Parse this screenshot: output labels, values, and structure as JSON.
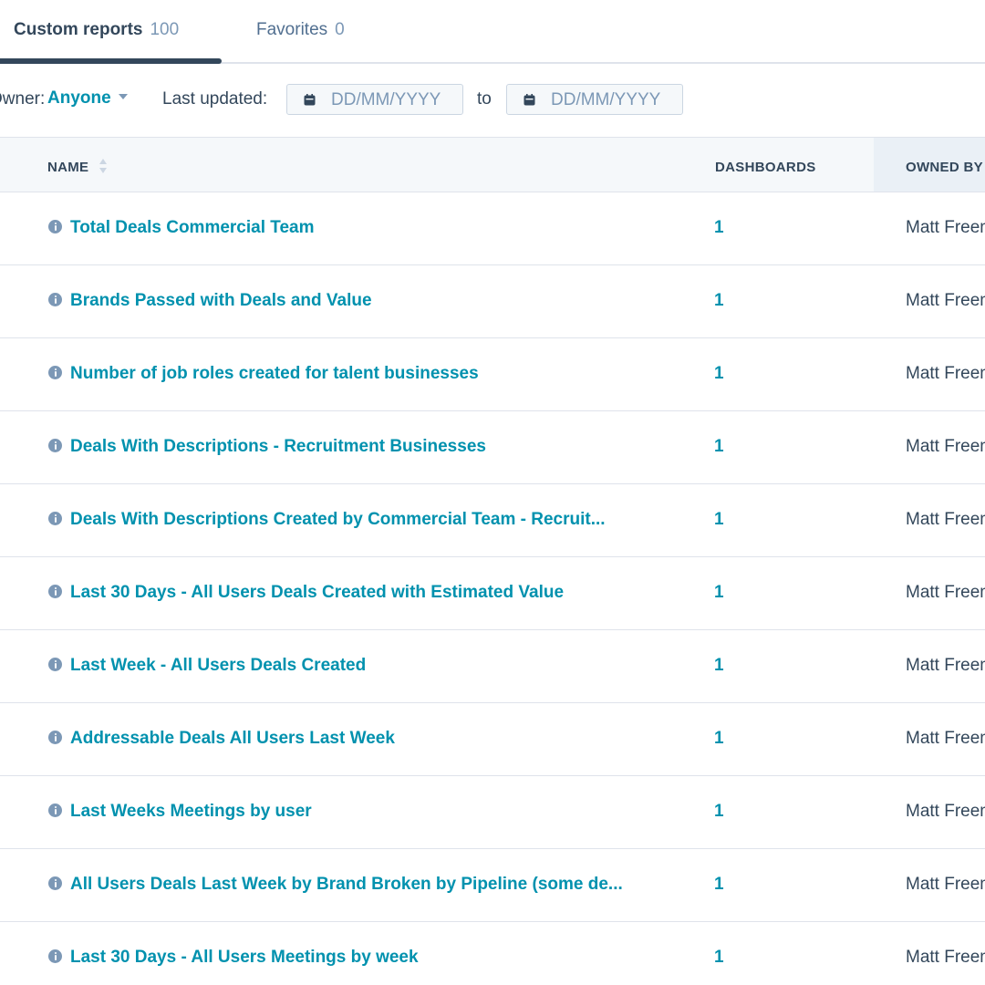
{
  "tabs": [
    {
      "label": "Custom reports",
      "count": "100"
    },
    {
      "label": "Favorites",
      "count": "0"
    }
  ],
  "filters": {
    "owner_label": "Owner:",
    "owner_value": "Anyone",
    "updated_label": "Last updated:",
    "date_from_placeholder": "DD/MM/YYYY",
    "to_label": "to",
    "date_to_placeholder": "DD/MM/YYYY"
  },
  "table": {
    "columns": {
      "name": "NAME",
      "dashboards": "DASHBOARDS",
      "owned_by": "OWNED BY"
    },
    "rows": [
      {
        "name": "Total Deals Commercial Team",
        "dashboards": "1",
        "owner": "Matt Freeman"
      },
      {
        "name": "Brands Passed with Deals and Value",
        "dashboards": "1",
        "owner": "Matt Freeman"
      },
      {
        "name": "Number of job roles created for talent businesses",
        "dashboards": "1",
        "owner": "Matt Freeman"
      },
      {
        "name": "Deals With Descriptions - Recruitment Businesses",
        "dashboards": "1",
        "owner": "Matt Freeman"
      },
      {
        "name": "Deals With Descriptions Created by Commercial Team - Recruit...",
        "dashboards": "1",
        "owner": "Matt Freeman"
      },
      {
        "name": "Last 30 Days - All Users Deals Created with Estimated Value",
        "dashboards": "1",
        "owner": "Matt Freeman"
      },
      {
        "name": "Last Week - All Users Deals Created",
        "dashboards": "1",
        "owner": "Matt Freeman"
      },
      {
        "name": "Addressable Deals All Users Last Week",
        "dashboards": "1",
        "owner": "Matt Freeman"
      },
      {
        "name": "Last Weeks Meetings by user",
        "dashboards": "1",
        "owner": "Matt Freeman"
      },
      {
        "name": "All Users Deals Last Week by Brand Broken by Pipeline (some de...",
        "dashboards": "1",
        "owner": "Matt Freeman"
      },
      {
        "name": "Last 30 Days - All Users Meetings by week",
        "dashboards": "1",
        "owner": "Matt Freeman"
      }
    ]
  },
  "colors": {
    "accent": "#0091ae",
    "text": "#33475b",
    "muted": "#7c98b6",
    "border": "#dfe3eb"
  },
  "icons": {
    "row_icon": "info-icon",
    "date_icon": "calendar-icon",
    "sort_icon": "sort-icon",
    "owner_dropdown": "caret-down-icon"
  }
}
